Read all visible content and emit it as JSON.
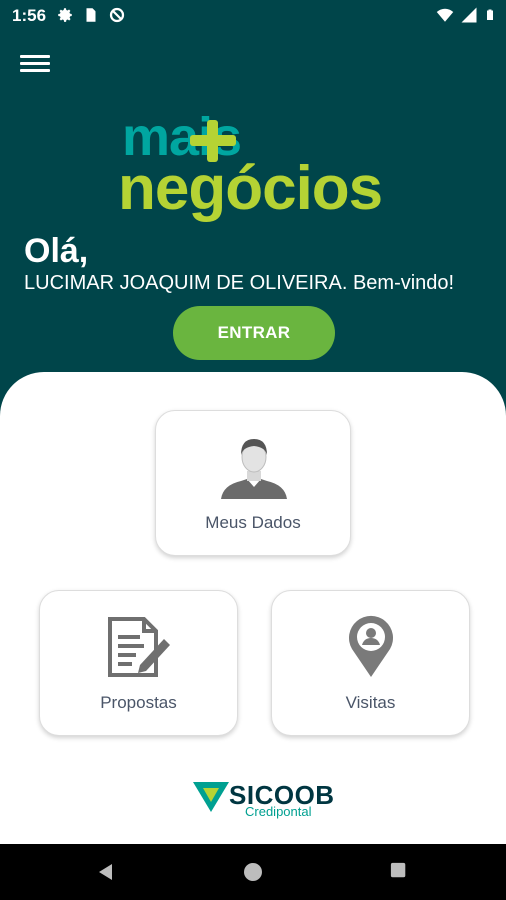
{
  "status_bar": {
    "time": "1:56",
    "left_icons": [
      "gear-icon",
      "sim-card-icon",
      "no-disturb-icon"
    ],
    "right_icons": [
      "wifi-icon",
      "signal-icon",
      "battery-icon"
    ]
  },
  "header": {
    "menu_icon": "hamburger-menu-icon",
    "logo": {
      "line1": "mais",
      "line2": "negócios"
    },
    "greeting": "Olá,",
    "welcome": "LUCIMAR JOAQUIM DE OLIVEIRA. Bem-vindo!",
    "enter_label": "ENTRAR"
  },
  "cards": {
    "meus_dados": {
      "label": "Meus Dados",
      "icon": "user-avatar-icon"
    },
    "propostas": {
      "label": "Propostas",
      "icon": "document-pen-icon"
    },
    "visitas": {
      "label": "Visitas",
      "icon": "location-pin-icon"
    }
  },
  "footer": {
    "brand": "SICOOB",
    "sub": "Credipontal"
  },
  "nav": {
    "back": "back-icon",
    "home": "home-icon",
    "recents": "recents-icon"
  },
  "colors": {
    "header_bg": "#00454a",
    "accent_green": "#6ab53f",
    "logo_teal": "#00a6a0",
    "logo_lime": "#b5d334"
  }
}
